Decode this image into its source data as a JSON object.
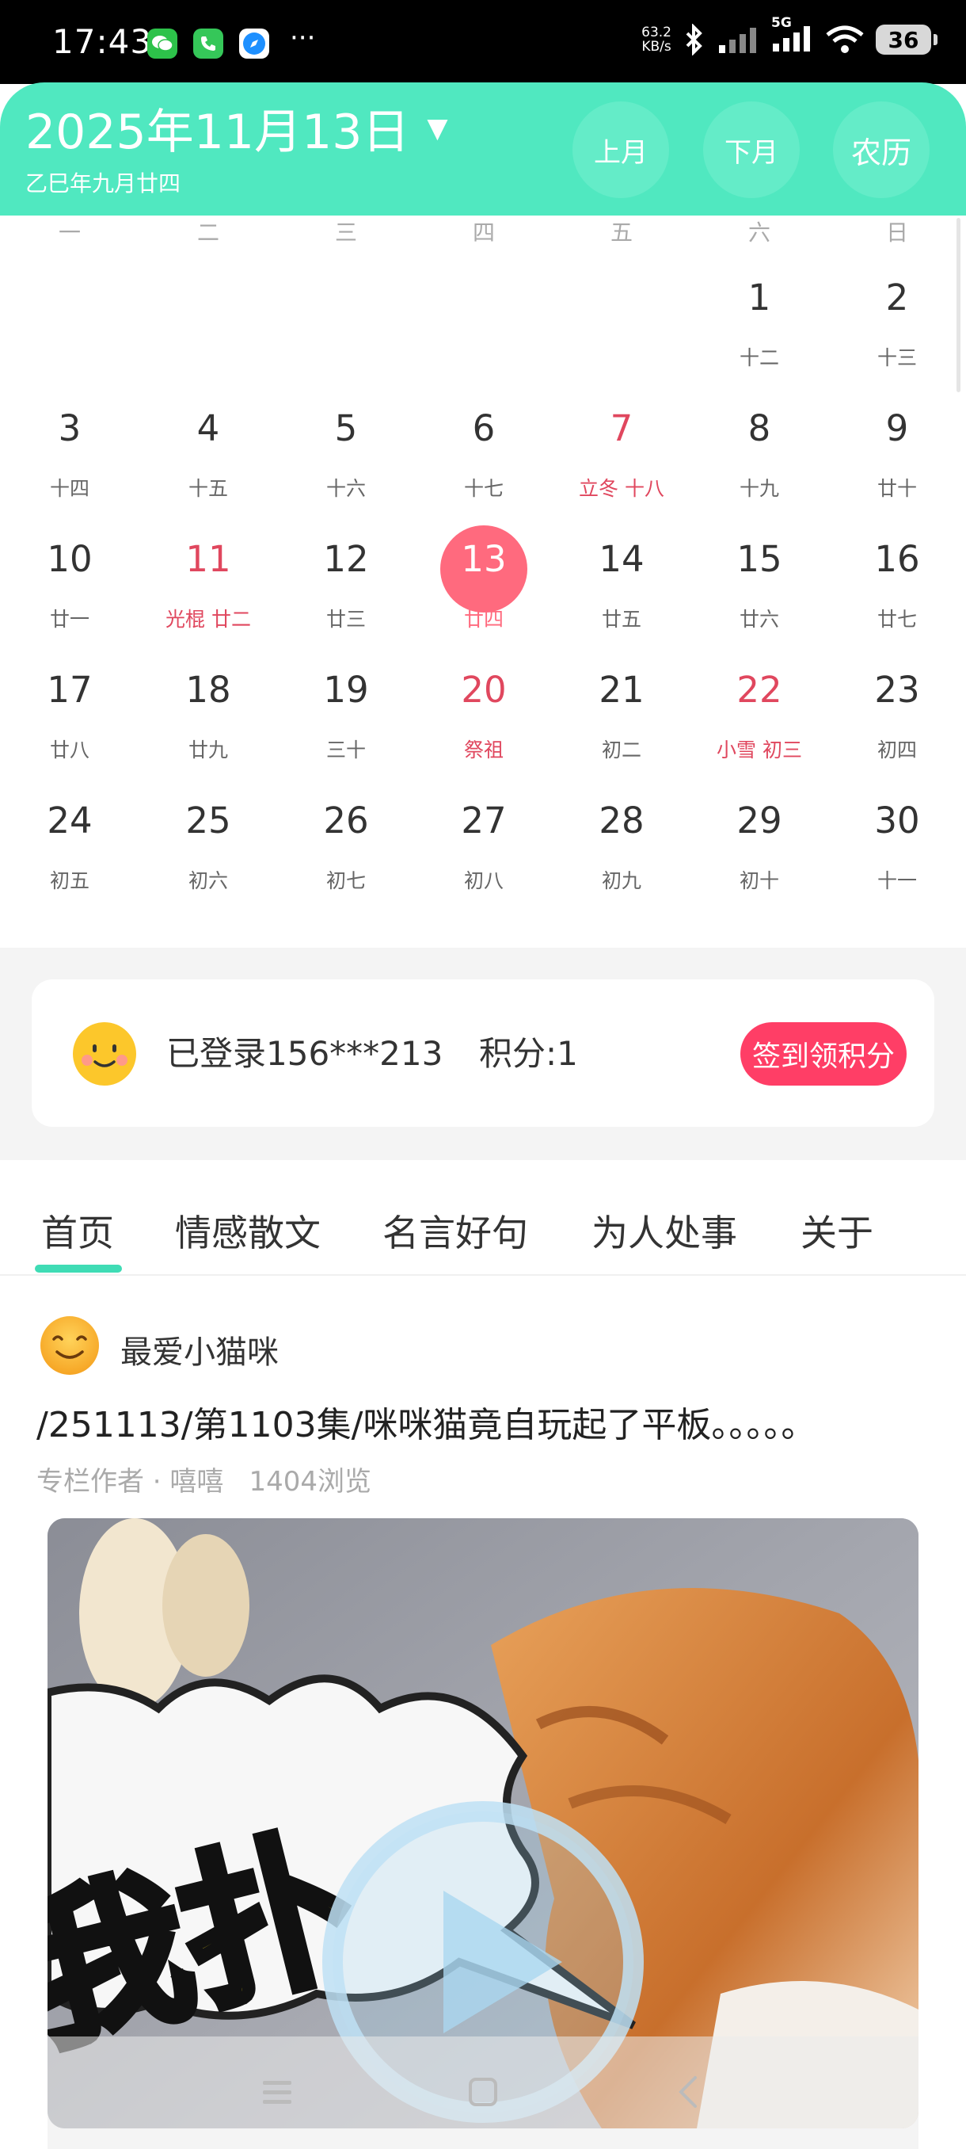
{
  "status_bar": {
    "time": "17:43",
    "apps": [
      {
        "name": "wechat-icon",
        "color": "#2dc24a"
      },
      {
        "name": "phone-icon",
        "color": "#35c759"
      },
      {
        "name": "browser-icon",
        "color": "#1e90ff"
      }
    ],
    "overflow": "···",
    "net_speed_value": "63.2",
    "net_speed_unit": "KB/s",
    "network_type": "5G",
    "battery": "36"
  },
  "calendar": {
    "title": "2025年11月13日",
    "lunar_date": "乙巳年九月廿四",
    "prev_month": "上月",
    "next_month": "下月",
    "lunar_toggle": "农历",
    "weekdays": [
      "一",
      "二",
      "三",
      "四",
      "五",
      "六",
      "日"
    ],
    "weeks": [
      [
        null,
        null,
        null,
        null,
        null,
        {
          "day": "1",
          "lunar": "十二"
        },
        {
          "day": "2",
          "lunar": "十三"
        }
      ],
      [
        {
          "day": "3",
          "lunar": "十四"
        },
        {
          "day": "4",
          "lunar": "十五"
        },
        {
          "day": "5",
          "lunar": "十六"
        },
        {
          "day": "6",
          "lunar": "十七"
        },
        {
          "day": "7",
          "lunar": "立冬 十八",
          "red": true
        },
        {
          "day": "8",
          "lunar": "十九"
        },
        {
          "day": "9",
          "lunar": "廿十"
        }
      ],
      [
        {
          "day": "10",
          "lunar": "廿一"
        },
        {
          "day": "11",
          "lunar": "光棍 廿二",
          "red": true
        },
        {
          "day": "12",
          "lunar": "廿三"
        },
        {
          "day": "13",
          "lunar": "廿四",
          "today": true
        },
        {
          "day": "14",
          "lunar": "廿五"
        },
        {
          "day": "15",
          "lunar": "廿六"
        },
        {
          "day": "16",
          "lunar": "廿七"
        }
      ],
      [
        {
          "day": "17",
          "lunar": "廿八"
        },
        {
          "day": "18",
          "lunar": "廿九"
        },
        {
          "day": "19",
          "lunar": "三十"
        },
        {
          "day": "20",
          "lunar": "祭祖",
          "red": true
        },
        {
          "day": "21",
          "lunar": "初二"
        },
        {
          "day": "22",
          "lunar": "小雪 初三",
          "red": true
        },
        {
          "day": "23",
          "lunar": "初四"
        }
      ],
      [
        {
          "day": "24",
          "lunar": "初五"
        },
        {
          "day": "25",
          "lunar": "初六"
        },
        {
          "day": "26",
          "lunar": "初七"
        },
        {
          "day": "27",
          "lunar": "初八"
        },
        {
          "day": "28",
          "lunar": "初九"
        },
        {
          "day": "29",
          "lunar": "初十"
        },
        {
          "day": "30",
          "lunar": "十一"
        }
      ]
    ]
  },
  "login": {
    "status": "已登录156***213",
    "points": "积分:1",
    "signin_button": "签到领积分"
  },
  "tabs": [
    {
      "label": "首页",
      "active": true
    },
    {
      "label": "情感散文"
    },
    {
      "label": "名言好句"
    },
    {
      "label": "为人处事"
    },
    {
      "label": "关于"
    }
  ],
  "article": {
    "author": "最爱小猫咪",
    "title": "/251113/第1103集/咪咪猫竟自玩起了平板。。。。。",
    "meta_role": "专栏作者 · 嘻嘻",
    "meta_views": "1404浏览",
    "thumb_caption": "我扑"
  },
  "colors": {
    "header": "#50e8c0",
    "accent_red": "#e0475e",
    "today_circle": "#ff6a7e",
    "signin": "#ff3e66",
    "tab_underline": "#3fdcb5"
  }
}
